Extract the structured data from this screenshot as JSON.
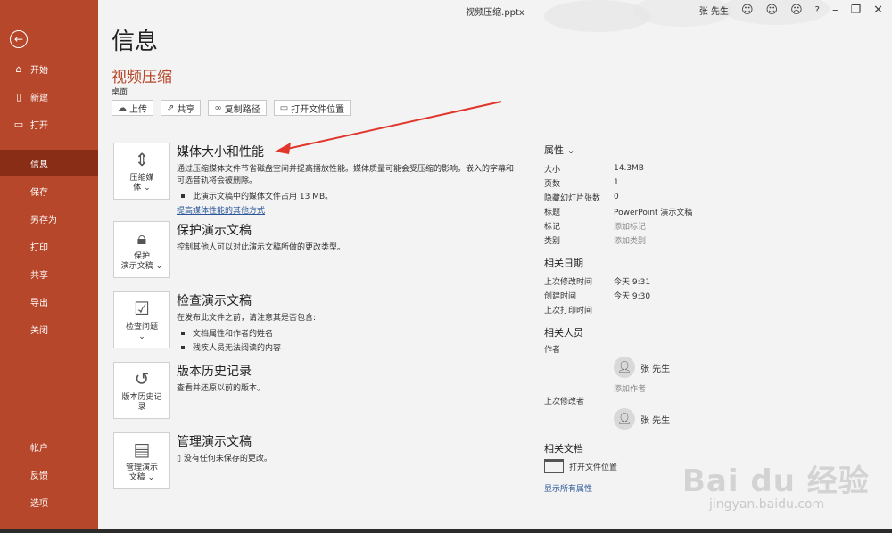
{
  "window": {
    "title": "视频压缩.pptx",
    "user": "张 先生",
    "help": "?"
  },
  "sidebar": {
    "items": [
      {
        "label": "开始",
        "icon": "home-icon"
      },
      {
        "label": "新建",
        "icon": "new-doc-icon"
      },
      {
        "label": "打开",
        "icon": "folder-open-icon"
      },
      {
        "label": "信息"
      },
      {
        "label": "保存"
      },
      {
        "label": "另存为"
      },
      {
        "label": "打印"
      },
      {
        "label": "共享"
      },
      {
        "label": "导出"
      },
      {
        "label": "关闭"
      }
    ],
    "bottom_items": [
      {
        "label": "帐户"
      },
      {
        "label": "反馈"
      },
      {
        "label": "选项"
      }
    ]
  },
  "main": {
    "page_title": "信息",
    "doc_name": "视频压缩",
    "doc_location": "桌面",
    "actions": [
      {
        "label": "上传",
        "icon": "cloud-upload-icon"
      },
      {
        "label": "共享",
        "icon": "share-icon"
      },
      {
        "label": "复制路径",
        "icon": "link-icon"
      },
      {
        "label": "打开文件位置",
        "icon": "folder-icon"
      }
    ],
    "sections": {
      "media": {
        "tile_label_1": "压缩媒",
        "tile_label_2": "体 ⌄",
        "title": "媒体大小和性能",
        "desc": "通过压缩媒体文件节省磁盘空间并提高播放性能。媒体质量可能会受压缩的影响。嵌入的字幕和可选音轨将会被删除。",
        "bullet": "此演示文稿中的媒体文件占用 13 MB。",
        "link": "提高媒体性能的其他方式"
      },
      "protect": {
        "tile_label_1": "保护",
        "tile_label_2": "演示文稿 ⌄",
        "title": "保护演示文稿",
        "desc": "控制其他人可以对此演示文稿所做的更改类型。"
      },
      "inspect": {
        "tile_label_1": "检查问题",
        "tile_label_2": "⌄",
        "title": "检查演示文稿",
        "desc": "在发布此文件之前，请注意其是否包含:",
        "bullets": [
          "文档属性和作者的姓名",
          "残疾人员无法阅读的内容"
        ]
      },
      "history": {
        "tile_label_1": "版本历史记",
        "tile_label_2": "录",
        "title": "版本历史记录",
        "desc": "查看并还原以前的版本。"
      },
      "manage": {
        "tile_label_1": "管理演示",
        "tile_label_2": "文稿 ⌄",
        "title": "管理演示文稿",
        "desc": "没有任何未保存的更改。"
      }
    }
  },
  "properties": {
    "header": "属性 ⌄",
    "rows": [
      {
        "key": "大小",
        "value": "14.3MB"
      },
      {
        "key": "页数",
        "value": "1"
      },
      {
        "key": "隐藏幻灯片张数",
        "value": "0"
      },
      {
        "key": "标题",
        "value": "PowerPoint 演示文稿"
      },
      {
        "key": "标记",
        "value": "添加标记"
      },
      {
        "key": "类别",
        "value": "添加类别"
      }
    ],
    "dates_header": "相关日期",
    "dates": [
      {
        "key": "上次修改时间",
        "value": "今天 9:31"
      },
      {
        "key": "创建时间",
        "value": "今天 9:30"
      },
      {
        "key": "上次打印时间",
        "value": ""
      }
    ],
    "people_header": "相关人员",
    "author_label": "作者",
    "author_name": "张 先生",
    "add_author": "添加作者",
    "last_modifier_label": "上次修改者",
    "last_modifier_name": "张 先生",
    "docs_header": "相关文档",
    "open_location": "打开文件位置",
    "show_all": "显示所有属性"
  },
  "watermark": {
    "main": "Bai du 经验",
    "sub": "jingyan.baidu.com"
  }
}
